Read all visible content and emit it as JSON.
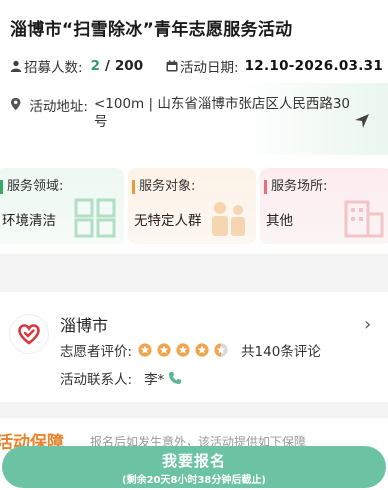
{
  "event": {
    "title": "淄博市“扫雪除冰”青年志愿服务活动",
    "recruit_label": "招募人数:",
    "recruit_current": "2",
    "recruit_sep": "/",
    "recruit_total": "200",
    "date_label": "活动日期:",
    "date_value": "12.10-2026.03.31",
    "address_label": "活动地址:",
    "address_value": "<100m | 山东省淄博市张店区人民西路30号"
  },
  "cards": [
    {
      "label": "服务领域:",
      "value": "环境清洁",
      "accent": "#3aa86b"
    },
    {
      "label": "服务对象:",
      "value": "无特定人群",
      "accent": "#e89a3c"
    },
    {
      "label": "服务场所:",
      "value": "其他",
      "accent": "#e0707a"
    }
  ],
  "org": {
    "name": "淄博市",
    "rating_label": "志愿者评价:",
    "rating": 4.5,
    "review_count": "共140条评论",
    "contact_label": "活动联系人:",
    "contact_name": "李*"
  },
  "next_section": {
    "title": "活动保障",
    "subtitle": "报名后如发生意外，该活动提供如下保障"
  },
  "signup": {
    "label": "我要报名",
    "countdown": "(剩余20天8小时38分钟后截止)"
  },
  "colors": {
    "primary_green": "#2e9e6a",
    "button": "#6cc3a3",
    "star": "#f0a44b"
  }
}
